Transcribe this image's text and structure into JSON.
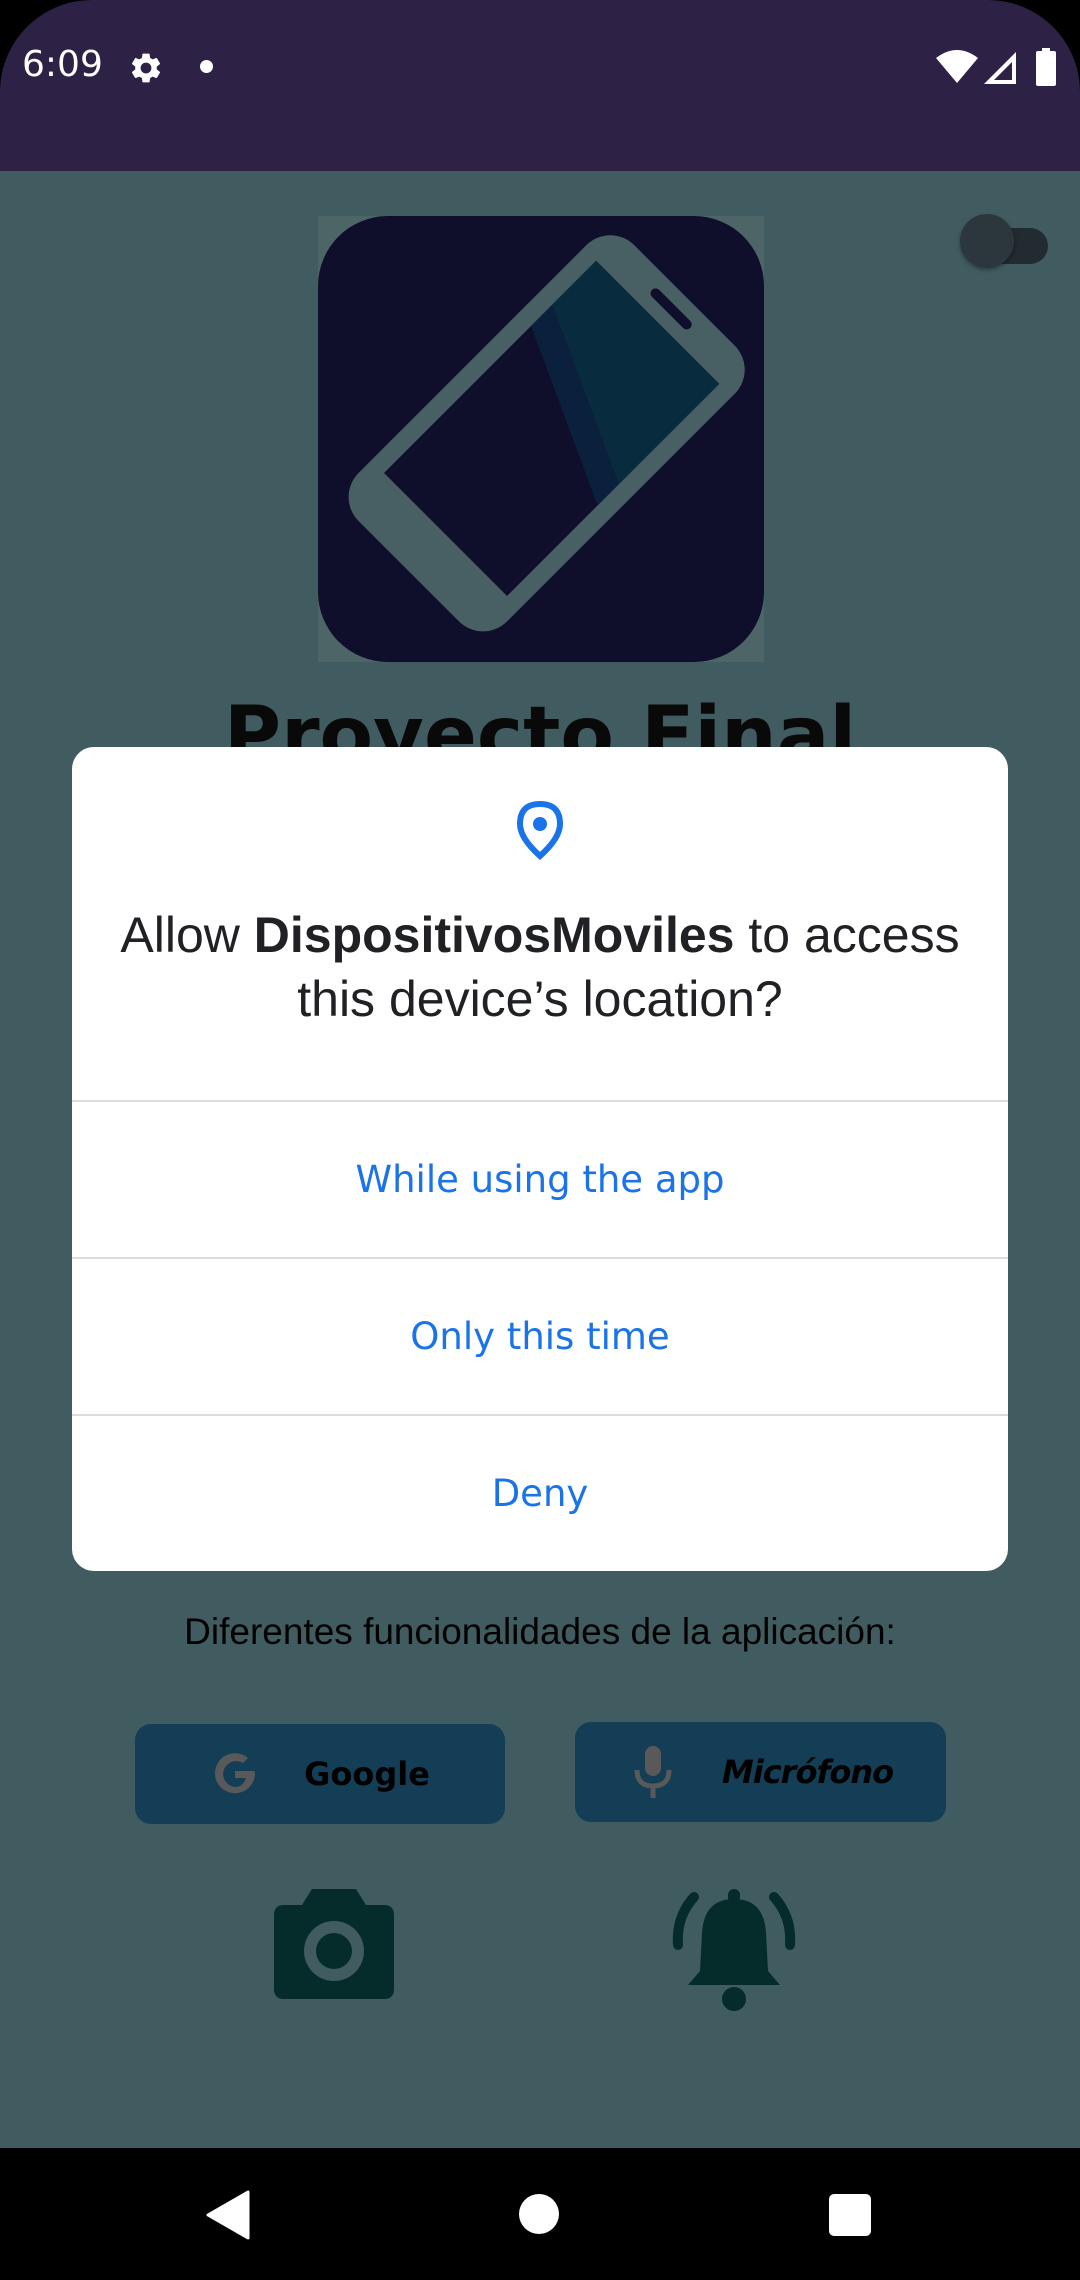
{
  "status_bar": {
    "time": "6:09",
    "icons": [
      "settings-gear-icon",
      "notification-dot-icon",
      "wifi-icon",
      "cell-signal-icon",
      "battery-icon"
    ]
  },
  "app": {
    "title": "Proyecto Final",
    "features_label": "Diferentes funcionalidades de la aplicación:",
    "google_button": "Google",
    "mic_button": "Micrófono",
    "icons": [
      "app-logo-phone-icon",
      "theme-switch",
      "google-g-icon",
      "microphone-icon",
      "camera-icon",
      "bell-ringing-icon"
    ]
  },
  "dialog": {
    "icon": "location-pin-icon",
    "title_prefix": "Allow ",
    "app_name": "DispositivosMoviles",
    "title_suffix": " to access this device’s location?",
    "options": [
      "While using the app",
      "Only this time",
      "Deny"
    ]
  },
  "nav_bar": {
    "icons": [
      "back-triangle-icon",
      "home-circle-icon",
      "recents-square-icon"
    ]
  },
  "colors": {
    "status_bar": "#2e2146",
    "app_background": "#6f9fa5",
    "button": "#226b94",
    "accent_link": "#1a73e8",
    "logo_background": "#1a1b4b"
  }
}
